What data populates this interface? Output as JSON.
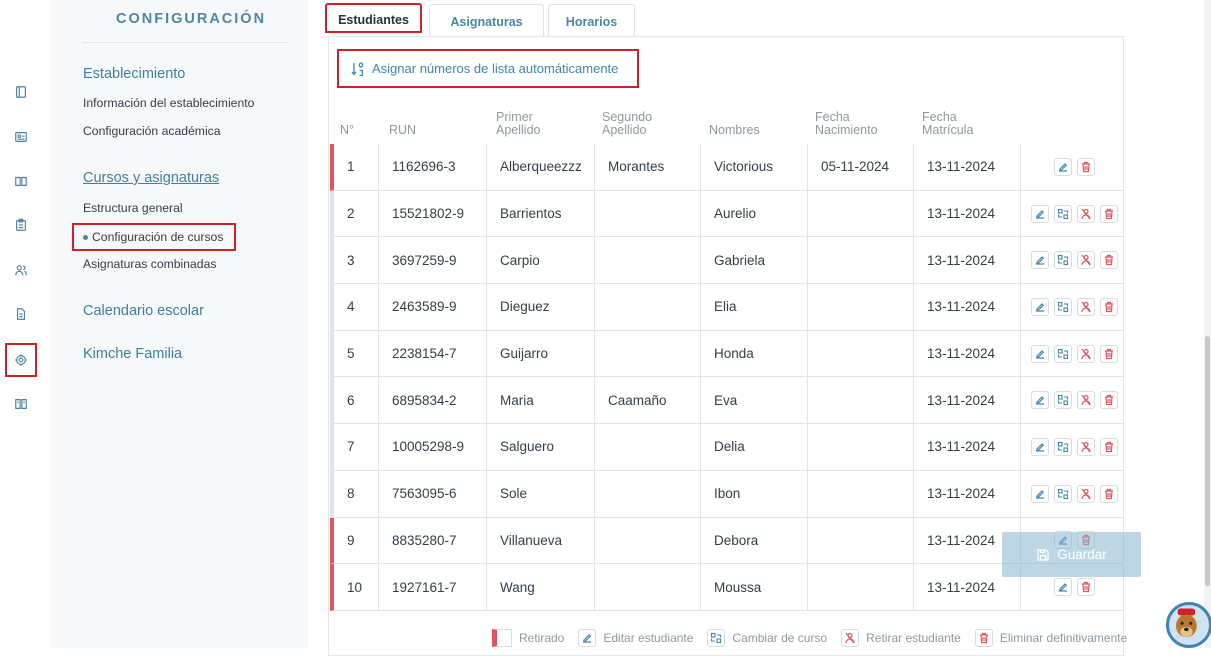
{
  "sidenav": {
    "title": "CONFIGURACIÓN",
    "establecimiento": "Establecimiento",
    "info": "Información del establecimiento",
    "academica": "Configuración académica",
    "cursos": "Cursos y asignaturas",
    "estructura": "Estructura general",
    "config_cursos": "Configuración de cursos",
    "combinadas": "Asignaturas combinadas",
    "calendario": "Calendario escolar",
    "familia": "Kimche Familia"
  },
  "rail_icons": [
    "book-icon",
    "id-card-icon",
    "open-book-icon",
    "clipboard-icon",
    "users-icon",
    "document-icon",
    "gear-icon",
    "reader-icon"
  ],
  "tabs": [
    "Estudiantes",
    "Asignaturas",
    "Horarios"
  ],
  "assign_label": "Asignar números de lista automáticamente",
  "headers": {
    "n": "N°",
    "run": "RUN",
    "primer_1": "Primer",
    "primer_2": "Apellido",
    "segundo_1": "Segundo",
    "segundo_2": "Apellido",
    "nombres": "Nombres",
    "fnac_1": "Fecha",
    "fnac_2": "Nacimiento",
    "fmat_1": "Fecha",
    "fmat_2": "Matrícula"
  },
  "students": [
    {
      "n": "1",
      "run": "1162696-3",
      "ap1": "Alberqueezzz",
      "ap2": "Morantes",
      "nombres": "Victorious",
      "fnac": "05-11-2024",
      "fmat": "13-11-2024",
      "retirado": true
    },
    {
      "n": "2",
      "run": "15521802-9",
      "ap1": "Barrientos",
      "ap2": "",
      "nombres": "Aurelio",
      "fnac": "",
      "fmat": "13-11-2024",
      "retirado": false
    },
    {
      "n": "3",
      "run": "3697259-9",
      "ap1": "Carpio",
      "ap2": "",
      "nombres": "Gabriela",
      "fnac": "",
      "fmat": "13-11-2024",
      "retirado": false
    },
    {
      "n": "4",
      "run": "2463589-9",
      "ap1": "Dieguez",
      "ap2": "",
      "nombres": "Elia",
      "fnac": "",
      "fmat": "13-11-2024",
      "retirado": false
    },
    {
      "n": "5",
      "run": "2238154-7",
      "ap1": "Guijarro",
      "ap2": "",
      "nombres": "Honda",
      "fnac": "",
      "fmat": "13-11-2024",
      "retirado": false
    },
    {
      "n": "6",
      "run": "6895834-2",
      "ap1": "Maria",
      "ap2": "Caamaño",
      "nombres": "Eva",
      "fnac": "",
      "fmat": "13-11-2024",
      "retirado": false
    },
    {
      "n": "7",
      "run": "10005298-9",
      "ap1": "Salguero",
      "ap2": "",
      "nombres": "Delia",
      "fnac": "",
      "fmat": "13-11-2024",
      "retirado": false
    },
    {
      "n": "8",
      "run": "7563095-6",
      "ap1": "Sole",
      "ap2": "",
      "nombres": "Ibon",
      "fnac": "",
      "fmat": "13-11-2024",
      "retirado": false
    },
    {
      "n": "9",
      "run": "8835280-7",
      "ap1": "Villanueva",
      "ap2": "",
      "nombres": "Debora",
      "fnac": "",
      "fmat": "13-11-2024",
      "retirado": true
    },
    {
      "n": "10",
      "run": "1927161-7",
      "ap1": "Wang",
      "ap2": "",
      "nombres": "Moussa",
      "fnac": "",
      "fmat": "13-11-2024",
      "retirado": true
    }
  ],
  "legend": {
    "retirado": "Retirado",
    "editar": "Editar estudiante",
    "cambiar": "Cambiar de curso",
    "retirar": "Retirar estudiante",
    "eliminar": "Eliminar definitivamente"
  },
  "save_label": "Guardar",
  "colors": {
    "accent": "#4a87a6",
    "link": "#3e86b0",
    "danger": "#e25560",
    "highlight": "#d0202a"
  }
}
